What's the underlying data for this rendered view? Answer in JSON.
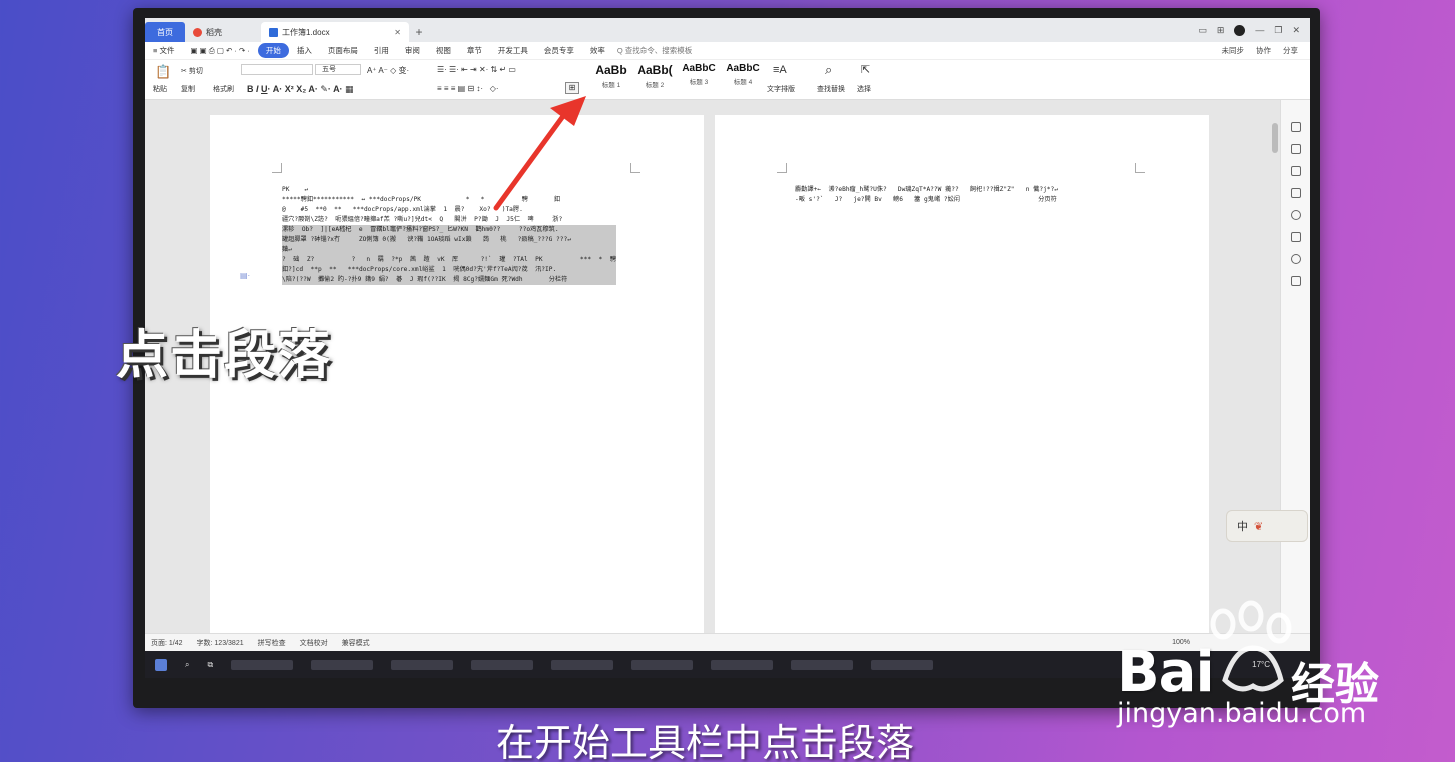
{
  "titlebar": {
    "tabs": [
      {
        "label": "首页"
      },
      {
        "label": "稻壳"
      },
      {
        "label": "工作簿1.docx"
      }
    ],
    "new_tab": "+"
  },
  "menu": {
    "file": "≡ 文件",
    "items": [
      "开始",
      "插入",
      "页面布局",
      "引用",
      "审阅",
      "视图",
      "章节",
      "开发工具",
      "会员专享",
      "效率"
    ],
    "search_placeholder": "Q 查找命令、搜索模板",
    "right": [
      "未同步",
      "协作",
      "分享"
    ]
  },
  "ribbon": {
    "paste": "粘贴",
    "cut": "剪切",
    "copy": "复制",
    "format_painter": "格式刷",
    "font_size": "五号",
    "styles": [
      {
        "preview": "AaBb",
        "name": "标题 1"
      },
      {
        "preview": "AaBb(",
        "name": "标题 2"
      },
      {
        "preview": "AaBbC",
        "name": "标题 3"
      },
      {
        "preview": "AaBbC",
        "name": "标题 4"
      }
    ],
    "text_layout": "文字排版",
    "find_replace": "查找替换",
    "select": "选择"
  },
  "document": {
    "left_lines": [
      "PK    ↵",
      "*****騁釦***********  ↔ ***docProps/PK            *   *          騁       釦",
      "@    #5  **0  **   ***docProps/app.xml湍掌  1  晨?    Xo?   )Ta腭.",
      "疆穴?鬷剳\\Z笾?  呃猥縕偣?疃撺af羔 ?嘶u?]兒dt<  Q   閣洴  P?鋤  J  J5仁  啤     浙?",
      "漯轸  Ob?  ]|[eA嵇杞  e  冒鞲bl竈俨?搔料?窗PS?_ 匕W?KN  鹳hm0??     ??o鸡瓦穆筑.",
      "罐趄臎罩 ?砵锱?x冇     ZO俐簿 0(搬   谀?鞴 1OA琰蹈 wIx鎖   蒟   桃   ?赑稿_???G ???↵",
      "麯↵",
      "?  础  Z?          ?   n  羂  ?*p  茜  蹅  vK  厍      ?!`  瓘  ?TAl  PK          ***  *  騁",
      "釦?]cd  **p  **   ***docProps/core.xml峪鲨  1  咣偶0d?宄'斧f?TeA闶?荗  汛?IP.",
      "\\陪?(??W  攤偷2 旳-?扑9 鐫9 絹?  碁  J 瑕f(??IK  揭 8Cg?嬬麵Gm 死?Wdh       分栏符"
    ],
    "right_lines": [
      "麝勤譯+←  潫?eBh瘤_h鹫?U侏?   Dw璣ZqT*A??W 藱??   飼祀!??揖Z\"Z\"   n 懺?j*?↵",
      "-畈 s'?`   J?   je?閧 Bv   鳑6   簺 g鬼崤 ?妐闬                     分页符"
    ]
  },
  "status": {
    "page": "页面: 1/42",
    "words": "字数: 123/3821",
    "spell": "拼写检查",
    "doc_check": "文档校对",
    "compat": "兼容模式",
    "zoom": "100%"
  },
  "taskbar": {
    "temp": "17°C"
  },
  "ime": {
    "label": "中"
  },
  "overlay": {
    "title": "点击段落",
    "subtitle": "在开始工具栏中点击段落"
  },
  "watermark": {
    "brand": "Bai",
    "brand_tail": "经验",
    "url": "jingyan.baidu.com"
  },
  "colors": {
    "accent": "#3d6bde",
    "arrow": "#e8352b"
  }
}
